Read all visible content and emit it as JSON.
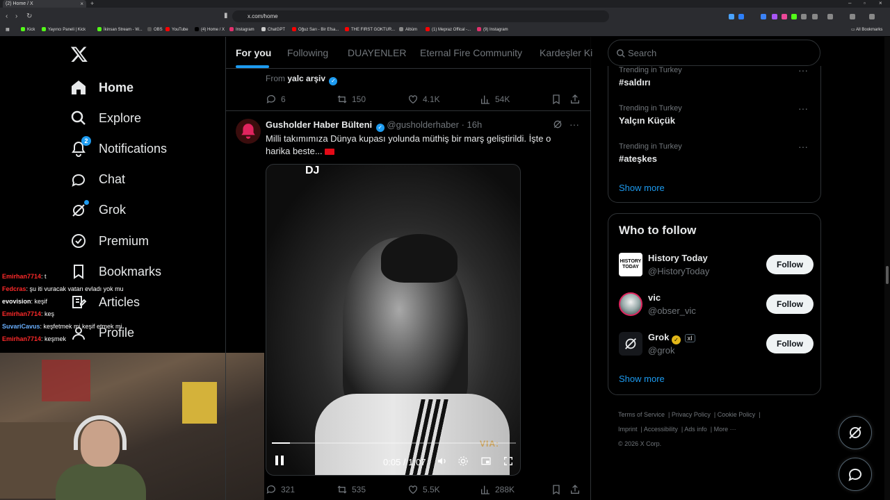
{
  "browser": {
    "tab_title": "(2) Home / X",
    "url": "x.com/home",
    "bookmarks": [
      {
        "label": "Kick",
        "color": "#53fc18"
      },
      {
        "label": "Yayıncı Paneli | Kick",
        "color": "#53fc18"
      },
      {
        "label": "İkinsan Stream - W...",
        "color": "#53fc18"
      },
      {
        "label": "OBS",
        "color": "#555555"
      },
      {
        "label": "YouTube",
        "color": "#ff0000"
      },
      {
        "label": "(4) Home / X",
        "color": "#000000"
      },
      {
        "label": "Instagram",
        "color": "#e1306c"
      },
      {
        "label": "ChatGPT",
        "color": "#cccccc"
      },
      {
        "label": "Oğuz Sarı - Bir Efsa...",
        "color": "#ff0000"
      },
      {
        "label": "THE FIRST GOKTUR...",
        "color": "#ff0000"
      },
      {
        "label": "Albüm",
        "color": "#888888"
      },
      {
        "label": "(1) Mepraz Offical -...",
        "color": "#ff0000"
      },
      {
        "label": "(9) Instagram",
        "color": "#e1306c"
      }
    ],
    "all_bookmarks": "All Bookmarks"
  },
  "nav": {
    "items": [
      {
        "label": "Home",
        "icon": "home-icon"
      },
      {
        "label": "Explore",
        "icon": "search-icon"
      },
      {
        "label": "Notifications",
        "icon": "bell-icon",
        "badge": "2"
      },
      {
        "label": "Chat",
        "icon": "chat-icon"
      },
      {
        "label": "Grok",
        "icon": "grok-icon"
      },
      {
        "label": "Premium",
        "icon": "premium-icon"
      },
      {
        "label": "Bookmarks",
        "icon": "bookmark-icon"
      },
      {
        "label": "Articles",
        "icon": "articles-icon"
      },
      {
        "label": "Profile",
        "icon": "profile-icon"
      }
    ]
  },
  "stream_chat": [
    {
      "user": "Emirhan7714",
      "text": ": t",
      "color": "#ff2a2a"
    },
    {
      "user": "Fedcras",
      "text": ": şu iti vuracak vatan evladı yok mu",
      "color": "#ff2a2a"
    },
    {
      "user": "evovision",
      "text": ": keşif",
      "color": "#ffffff"
    },
    {
      "user": "Emirhan7714",
      "text": ": keş",
      "color": "#ff2a2a"
    },
    {
      "user": "SuvariCavus",
      "text": ": keşfetmek mi keşif etmek mi",
      "color": "#6ab0ff"
    },
    {
      "user": "Emirhan7714",
      "text": ": keşmek",
      "color": "#ff2a2a"
    }
  ],
  "timeline": {
    "tabs": [
      "For you",
      "Following",
      "DUAYENLER",
      "Eternal Fire Community",
      "Kardeşler Ki"
    ],
    "prev_tweet": {
      "from_prefix": "From",
      "from_name": "yalc arşiv",
      "replies": "6",
      "reposts": "150",
      "likes": "4.1K",
      "views": "54K"
    },
    "tweet": {
      "name": "Gusholder Haber Bülteni",
      "handle": "@gusholderhaber",
      "time": "· 16h",
      "text": "Milli takımımıza Dünya kupası yolunda müthiş bir marş geliştirildi. İşte o harika beste...",
      "video_time": "0:05 / 1:07",
      "video_progress": 0.075,
      "video_overlay_top": "DJ",
      "video_watermark": "VIA:",
      "replies": "321",
      "reposts": "535",
      "likes": "5.5K",
      "views": "288K"
    }
  },
  "sidebar": {
    "search_placeholder": "Search",
    "trends": [
      {
        "context": "Trending in Turkey",
        "name": "#saldırı"
      },
      {
        "context": "Trending in Turkey",
        "name": "Yalçın Küçük"
      },
      {
        "context": "Trending in Turkey",
        "name": "#ateşkes"
      }
    ],
    "trends_show_more": "Show more",
    "who_to_follow_title": "Who to follow",
    "accounts": [
      {
        "name": "History Today",
        "handle": "@HistoryToday",
        "follow": "Follow",
        "avatar_text": "HISTORY TODAY"
      },
      {
        "name": "vic",
        "handle": "@obser_vic",
        "follow": "Follow"
      },
      {
        "name": "Grok",
        "handle": "@grok",
        "follow": "Follow",
        "tag": "xI"
      }
    ],
    "wtf_show_more": "Show more",
    "footer_links": [
      "Terms of Service",
      "Privacy Policy",
      "Cookie Policy",
      "Imprint",
      "Accessibility",
      "Ads info",
      "More ···"
    ],
    "copyright": "© 2026 X Corp."
  }
}
